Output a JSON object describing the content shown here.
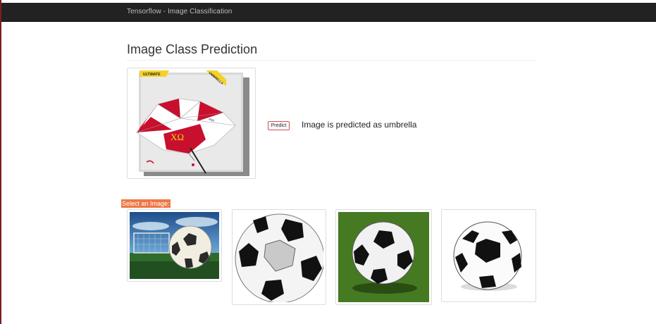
{
  "navbar": {
    "brand": "Tensorflow - Image Classification"
  },
  "main": {
    "title": "Image Class Prediction",
    "predict_button": "Predict",
    "prediction_text": "Image is predicted as umbrella",
    "select_label": "Select an Image:"
  },
  "selected_image": {
    "subject": "umbrella",
    "banner_left": "ULTIMATE",
    "banner_right": "UMBRELLA",
    "letters": "ΧΩ"
  },
  "gallery": [
    {
      "subject": "soccer ball on grass field with goal"
    },
    {
      "subject": "black and white soccer ball"
    },
    {
      "subject": "soccer ball on grass"
    },
    {
      "subject": "soccer ball on white background"
    }
  ],
  "colors": {
    "navbar": "#222222",
    "accent": "#ee7744",
    "button_border": "#d9534f"
  }
}
